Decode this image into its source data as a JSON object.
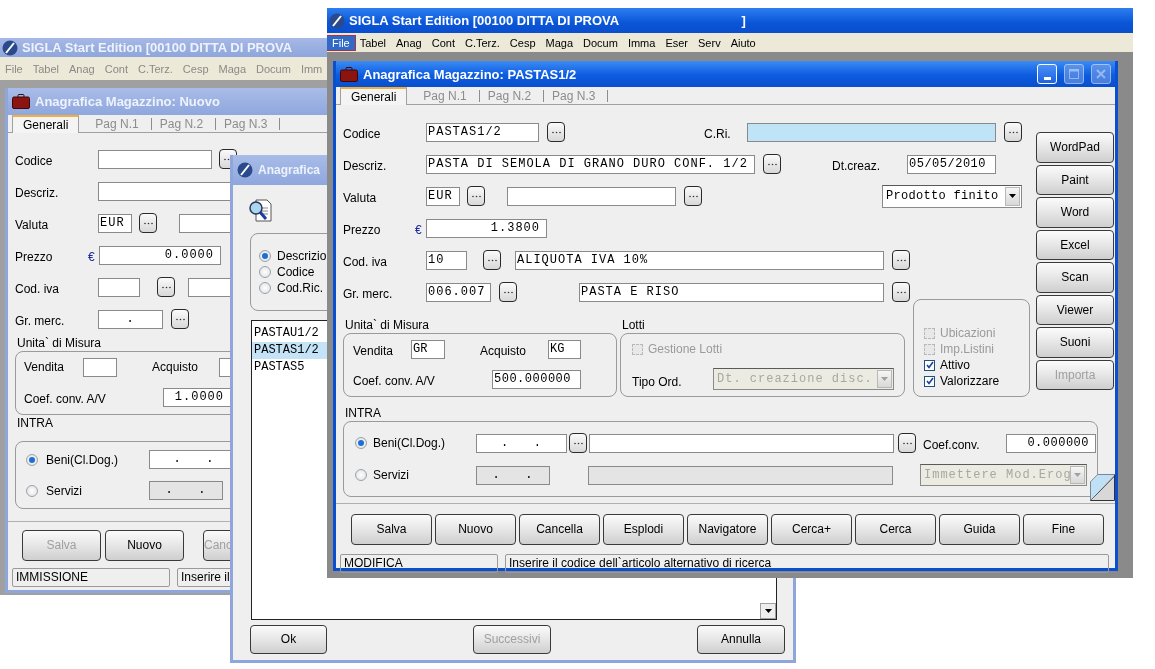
{
  "back_window": {
    "title": "SIGLA Start Edition [00100 DITTA DI PROVA",
    "menu": [
      "File",
      "Tabel",
      "Anag",
      "Cont",
      "C.Terz.",
      "Cesp",
      "Maga",
      "Docum",
      "Imm"
    ],
    "form": {
      "title": "Anagrafica Magazzino: Nuovo",
      "tabs": [
        {
          "label": "Generali",
          "selected": true
        },
        {
          "label": "Pag N.1",
          "selected": false
        },
        {
          "label": "Pag N.2",
          "selected": false
        },
        {
          "label": "Pag N.3",
          "selected": false
        }
      ],
      "codice_label": "Codice",
      "descriz_label": "Descriz.",
      "valuta_label": "Valuta",
      "valuta_value": "EUR",
      "prezzo_label": "Prezzo",
      "currency": "€",
      "prezzo_value": "0.0000",
      "cod_iva_label": "Cod. iva",
      "gr_merc_label": "Gr. merc.",
      "gr_merc_value": ".",
      "unita_label": "Unita` di Misura",
      "vendita_label": "Vendita",
      "acquisto_label": "Acquisto",
      "coef_label": "Coef. conv. A/V",
      "coef_value": "1.0000",
      "intra_label": "INTRA",
      "intra_options": [
        {
          "label": "Beni(Cl.Dog.)",
          "selected": true,
          "value": ".   ."
        },
        {
          "label": "Servizi",
          "selected": false,
          "value": ".   ."
        }
      ],
      "buttons": [
        {
          "label": "Salva",
          "disabled": true
        },
        {
          "label": "Nuovo",
          "disabled": false
        },
        {
          "label": "Canc",
          "disabled": true
        }
      ],
      "status": {
        "mode": "IMMISSIONE",
        "message": "Inserire il"
      }
    }
  },
  "search_dialog": {
    "title": "Anagrafica",
    "search_by": [
      {
        "label": "Descrizio",
        "selected": true
      },
      {
        "label": "Codice",
        "selected": false
      },
      {
        "label": "Cod.Ric.",
        "selected": false
      }
    ],
    "results": [
      {
        "label": "PASTAU1/2",
        "selected": false
      },
      {
        "label": "PASTAS1/2",
        "selected": true
      },
      {
        "label": "PASTAS5",
        "selected": false
      }
    ],
    "buttons": [
      {
        "label": "Ok",
        "disabled": false
      },
      {
        "label": "Successivi",
        "disabled": true
      },
      {
        "label": "Annulla",
        "disabled": false
      }
    ]
  },
  "main_window": {
    "title": "SIGLA Start Edition [00100 DITTA DI PROVA                                  ]",
    "menu": [
      {
        "label": "File",
        "selected": true
      },
      {
        "label": "Tabel",
        "selected": false
      },
      {
        "label": "Anag",
        "selected": false
      },
      {
        "label": "Cont",
        "selected": false
      },
      {
        "label": "C.Terz.",
        "selected": false
      },
      {
        "label": "Cesp",
        "selected": false
      },
      {
        "label": "Maga",
        "selected": false
      },
      {
        "label": "Docum",
        "selected": false
      },
      {
        "label": "Imma",
        "selected": false
      },
      {
        "label": "Eser",
        "selected": false
      },
      {
        "label": "Serv",
        "selected": false
      },
      {
        "label": "Aiuto",
        "selected": false
      }
    ],
    "form": {
      "title": "Anagrafica Magazzino: PASTAS1/2",
      "title_buttons": [
        {
          "kind": "minimize",
          "disabled": false
        },
        {
          "kind": "maximize",
          "disabled": true
        },
        {
          "kind": "close",
          "disabled": true
        }
      ],
      "tabs": [
        {
          "label": "Generali",
          "selected": true
        },
        {
          "label": "Pag N.1",
          "selected": false
        },
        {
          "label": "Pag N.2",
          "selected": false
        },
        {
          "label": "Pag N.3",
          "selected": false
        }
      ],
      "codice": {
        "label": "Codice",
        "value": "PASTAS1/2"
      },
      "cri": {
        "label": "C.Ri."
      },
      "descriz": {
        "label": "Descriz.",
        "value": "PASTA DI SEMOLA DI GRANO DURO CONF. 1/2"
      },
      "dt_creaz": {
        "label": "Dt.creaz.",
        "value": "05/05/2010"
      },
      "valuta": {
        "label": "Valuta",
        "value": "EUR"
      },
      "tipo": {
        "value": "Prodotto finito"
      },
      "prezzo": {
        "label": "Prezzo",
        "currency": "€",
        "value": "1.3800"
      },
      "cod_iva": {
        "label": "Cod. iva",
        "value": "10",
        "description": "ALIQUOTA IVA 10%"
      },
      "gr_merc": {
        "label": "Gr. merc.",
        "value": "006.007",
        "description": "PASTA E RISO"
      },
      "unita": {
        "label": "Unita` di Misura",
        "vendita_label": "Vendita",
        "vendita": "GR",
        "acquisto_label": "Acquisto",
        "acquisto": "KG",
        "coef_label": "Coef. conv. A/V",
        "coef": "500.000000"
      },
      "lotti": {
        "label": "Lotti",
        "gestione": {
          "label": "Gestione Lotti",
          "checked": false,
          "disabled": true
        },
        "tipo_ord_label": "Tipo Ord.",
        "tipo_ord": {
          "value": "Dt. creazione disc.",
          "disabled": true
        }
      },
      "flags": [
        {
          "label": "Ubicazioni",
          "checked": false,
          "disabled": true
        },
        {
          "label": "Imp.Listini",
          "checked": false,
          "disabled": true
        },
        {
          "label": "Attivo",
          "checked": true,
          "disabled": false
        },
        {
          "label": "Valorizzare",
          "checked": true,
          "disabled": false
        }
      ],
      "intra": {
        "label": "INTRA",
        "options": [
          {
            "label": "Beni(Cl.Dog.)",
            "selected": true,
            "value": ".   ."
          },
          {
            "label": "Servizi",
            "selected": false,
            "value": ".   ."
          }
        ],
        "coef_label": "Coef.conv.",
        "coef": "0.000000",
        "mod_erog": {
          "value": "Immettere Mod.Erog",
          "disabled": true
        }
      },
      "side_buttons": [
        {
          "label": "WordPad",
          "disabled": false
        },
        {
          "label": "Paint",
          "disabled": false
        },
        {
          "label": "Word",
          "disabled": false
        },
        {
          "label": "Excel",
          "disabled": false
        },
        {
          "label": "Scan",
          "disabled": false
        },
        {
          "label": "Viewer",
          "disabled": false
        },
        {
          "label": "Suoni",
          "disabled": false
        },
        {
          "label": "Importa",
          "disabled": true
        }
      ],
      "buttons": [
        {
          "label": "Salva",
          "disabled": false
        },
        {
          "label": "Nuovo",
          "disabled": false
        },
        {
          "label": "Cancella",
          "disabled": false
        },
        {
          "label": "Esplodi",
          "disabled": false
        },
        {
          "label": "Navigatore",
          "disabled": false
        },
        {
          "label": "Cerca+",
          "disabled": false
        },
        {
          "label": "Cerca",
          "disabled": false
        },
        {
          "label": "Guida",
          "disabled": false
        },
        {
          "label": "Fine",
          "disabled": false
        }
      ],
      "status": {
        "mode": "MODIFICA",
        "message": "Inserire il codice dell`articolo alternativo di ricerca"
      }
    }
  }
}
